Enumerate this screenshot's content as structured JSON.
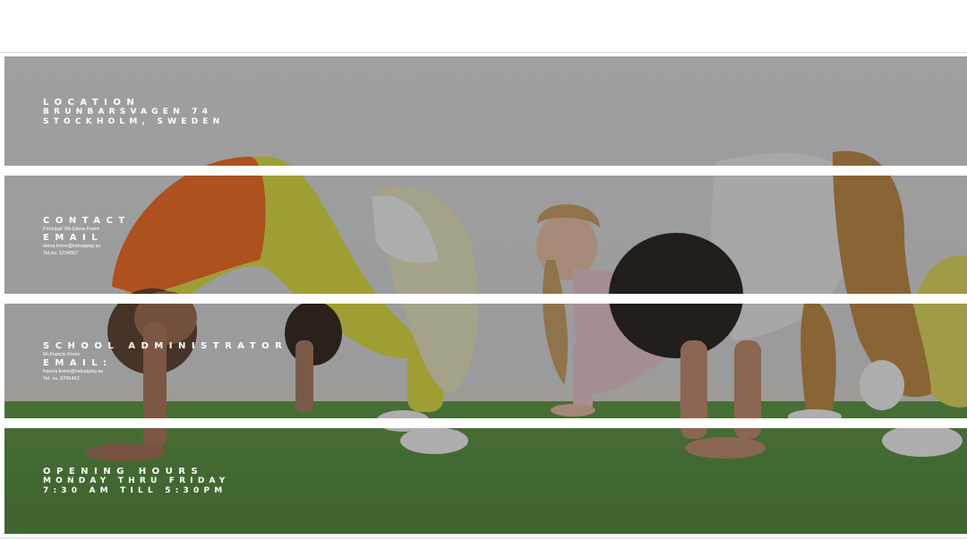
{
  "location": {
    "heading": "LOCATION",
    "line1": "BRUNBARSVAGEN 74",
    "line2": "STOCKHOLM, SWEDEN"
  },
  "contact": {
    "heading": "CONTACT",
    "principal": "Principal: Ms.Elena Freire",
    "email_heading": "EMAIL",
    "email": "elena.freire@kidsatplay.se",
    "tel": "Tel.no. 1234567"
  },
  "administrator": {
    "heading": "SCHOOL ADMINISTRATOR",
    "name": "Mr.Francis Freire",
    "email_heading": "EMAIL:",
    "email": "francis.freire@kidsatplay.se",
    "tel": "Tel. no. 8765463"
  },
  "hours": {
    "heading": "OPENING HOURS",
    "line1": "MONDAY THRU FRIDAY",
    "line2": "7:30 AM TILL 5:30PM"
  }
}
